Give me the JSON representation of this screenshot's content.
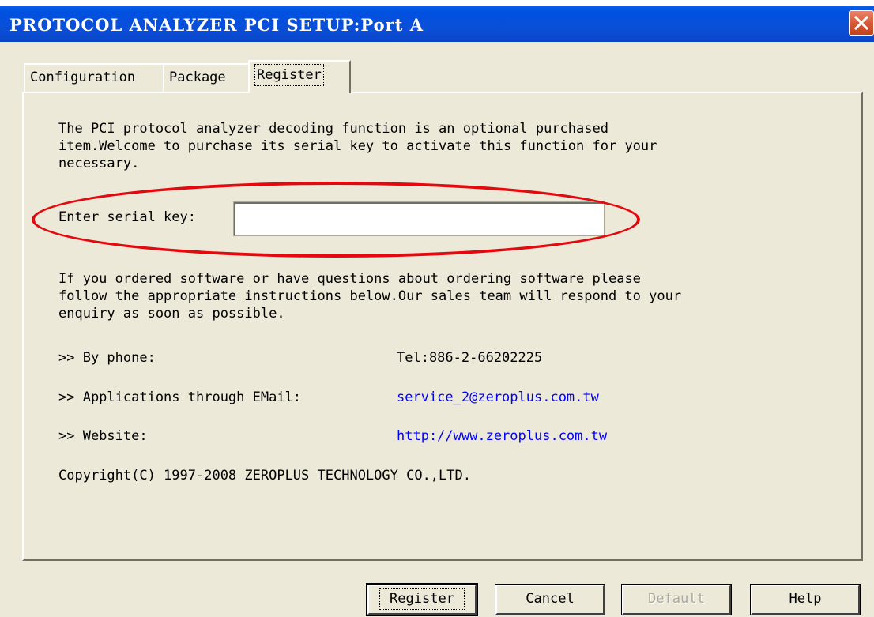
{
  "window": {
    "title": "PROTOCOL ANALYZER PCI SETUP:Port A",
    "close_icon": "close-icon"
  },
  "tabs": [
    {
      "label": "Configuration"
    },
    {
      "label": "Package"
    },
    {
      "label": "Register",
      "selected": true
    }
  ],
  "register": {
    "intro": "The PCI protocol analyzer decoding function is an optional purchased\nitem.Welcome to purchase its serial key to activate this function for your\nnecessary.",
    "serial_label": "Enter serial key:",
    "serial_value": "",
    "ordering_info": "If you ordered software or have questions about ordering software please\nfollow the appropriate instructions below.Our sales team will respond to your\nenquiry as soon as possible.",
    "contacts": [
      {
        "label": ">> By phone:",
        "value": "Tel:886-2-66202225"
      },
      {
        "label": ">> Applications through EMail:",
        "value": "service_2@zeroplus.com.tw"
      },
      {
        "label": ">> Website:",
        "value": "http://www.zeroplus.com.tw"
      }
    ],
    "copyright": "Copyright(C) 1997-2008 ZEROPLUS TECHNOLOGY CO.,LTD."
  },
  "buttons": {
    "register": "Register",
    "cancel": "Cancel",
    "default": "Default",
    "help": "Help"
  },
  "colors": {
    "title_bar": "#0a4fd8",
    "dialog_bg": "#ece9d8",
    "link": "#0000ff",
    "highlight": "#e3090f",
    "disabled_text": "#aca899"
  }
}
